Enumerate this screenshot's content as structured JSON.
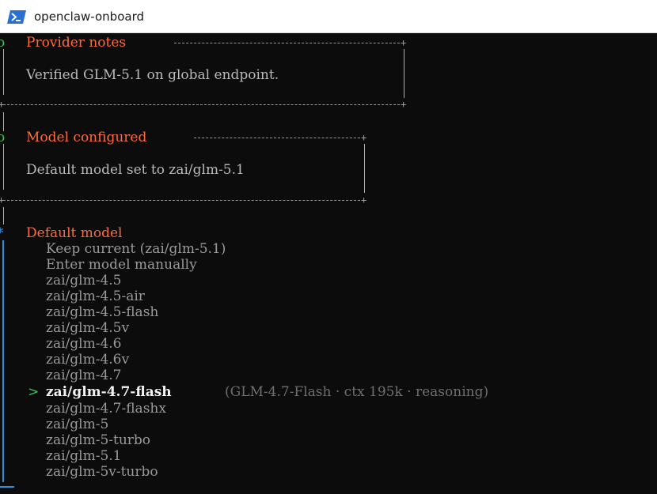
{
  "window": {
    "title": "openclaw-onboard",
    "icon": "powershell-icon"
  },
  "colors": {
    "heading": "#ff6a3d",
    "pointer": "#3ec45a",
    "accent_blue": "#2f8fd8",
    "background": "#0c0c0c"
  },
  "provider_notes": {
    "title": "Provider notes",
    "message": "Verified GLM-5.1 on global endpoint."
  },
  "model_configured": {
    "title": "Model configured",
    "message": "Default model set to zai/glm-5.1"
  },
  "default_model": {
    "title": "Default model",
    "pointer": ">",
    "selected_index": 9,
    "selected_description": "(GLM-4.7-Flash · ctx 195k · reasoning)",
    "options": [
      "Keep current (zai/glm-5.1)",
      "Enter model manually",
      "zai/glm-4.5",
      "zai/glm-4.5-air",
      "zai/glm-4.5-flash",
      "zai/glm-4.5v",
      "zai/glm-4.6",
      "zai/glm-4.6v",
      "zai/glm-4.7",
      "zai/glm-4.7-flash",
      "zai/glm-4.7-flashx",
      "zai/glm-5",
      "zai/glm-5-turbo",
      "zai/glm-5.1",
      "zai/glm-5v-turbo"
    ]
  }
}
